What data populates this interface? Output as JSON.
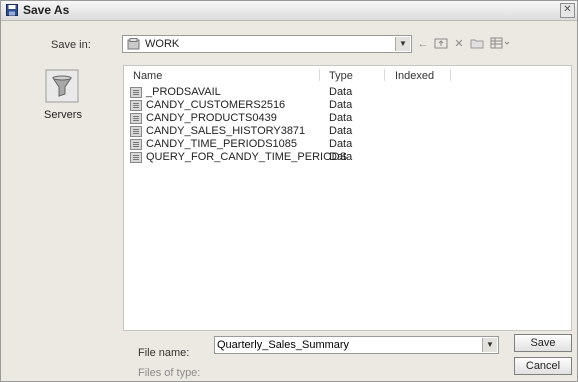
{
  "window": {
    "title": "Save As",
    "close_glyph": "✕"
  },
  "save_in": {
    "label": "Save in:",
    "value": "WORK",
    "icon": "library-icon"
  },
  "toolbar": {
    "icons": [
      "back-arrow-icon",
      "up-folder-icon",
      "delete-icon",
      "new-folder-icon",
      "views-menu-icon"
    ]
  },
  "places_bar": {
    "items": [
      {
        "label": "Servers",
        "icon": "servers-icon"
      }
    ]
  },
  "file_list": {
    "columns": [
      "Name",
      "Type",
      "Indexed"
    ],
    "rows": [
      {
        "name": "_PRODSAVAIL",
        "type": "Data"
      },
      {
        "name": "CANDY_CUSTOMERS2516",
        "type": "Data"
      },
      {
        "name": "CANDY_PRODUCTS0439",
        "type": "Data"
      },
      {
        "name": "CANDY_SALES_HISTORY3871",
        "type": "Data"
      },
      {
        "name": "CANDY_TIME_PERIODS1085",
        "type": "Data"
      },
      {
        "name": "QUERY_FOR_CANDY_TIME_PERIODS",
        "type": "Data"
      }
    ]
  },
  "file_name": {
    "label": "File name:",
    "value": "Quarterly_Sales_Summary"
  },
  "file_type": {
    "label": "Files of type:"
  },
  "buttons": {
    "save": "Save",
    "cancel": "Cancel"
  },
  "colors": {
    "dialog_bg": "#ece9e2",
    "selection": "#316ac5"
  }
}
